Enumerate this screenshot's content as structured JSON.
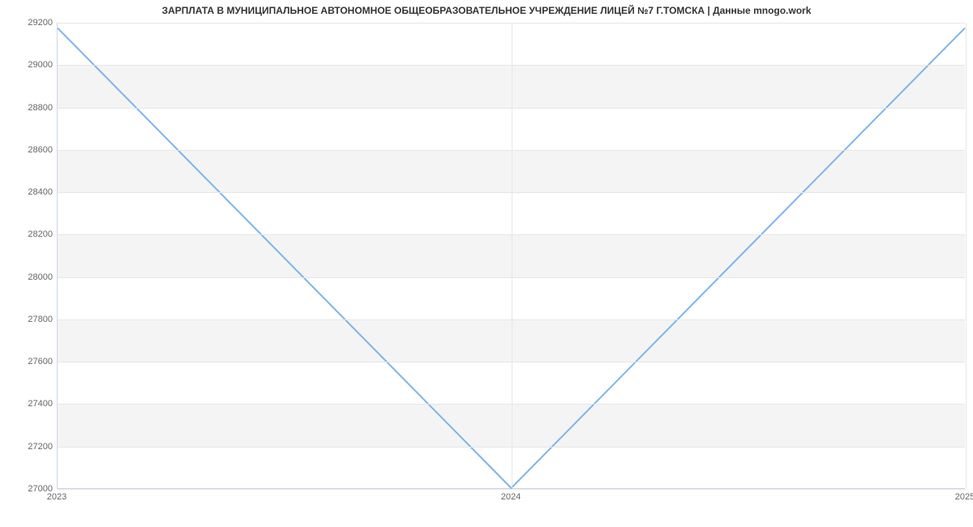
{
  "chart_data": {
    "type": "line",
    "title": "ЗАРПЛАТА В МУНИЦИПАЛЬНОЕ АВТОНОМНОЕ ОБЩЕОБРАЗОВАТЕЛЬНОЕ УЧРЕЖДЕНИЕ ЛИЦЕЙ №7 Г.ТОМСКА | Данные mnogo.work",
    "x": [
      "2023",
      "2024",
      "2025"
    ],
    "values": [
      29175,
      27000,
      29175
    ],
    "ylim": [
      27000,
      29200
    ],
    "yticks": [
      27000,
      27200,
      27400,
      27600,
      27800,
      28000,
      28200,
      28400,
      28600,
      28800,
      29000,
      29200
    ],
    "line_color": "#7cb5ec",
    "band_color": "#f4f4f4"
  }
}
